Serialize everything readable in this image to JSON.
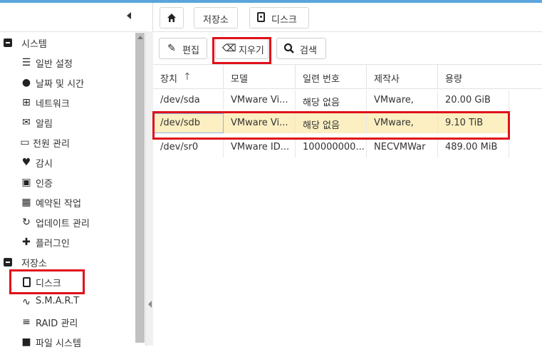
{
  "breadcrumb": {
    "home_icon": "home-icon",
    "storage": "저장소",
    "disk": "디스크"
  },
  "toolbar": {
    "edit": "편집",
    "wipe": "지우기",
    "search": "검색"
  },
  "sidebar": {
    "groups": [
      {
        "label": "시스템"
      },
      {
        "label": "저장소"
      }
    ],
    "system_items": [
      {
        "label": "일반 설정",
        "icon": "sliders-icon"
      },
      {
        "label": "날짜 및 시간",
        "icon": "clock-icon"
      },
      {
        "label": "네트워크",
        "icon": "network-icon"
      },
      {
        "label": "알림",
        "icon": "envelope-icon"
      },
      {
        "label": "전원 관리",
        "icon": "battery-icon"
      },
      {
        "label": "감시",
        "icon": "heartbeat-icon"
      },
      {
        "label": "인증",
        "icon": "certificate-icon"
      },
      {
        "label": "예약된 작업",
        "icon": "calendar-icon"
      },
      {
        "label": "업데이트 관리",
        "icon": "refresh-icon"
      },
      {
        "label": "플러그인",
        "icon": "puzzle-icon"
      }
    ],
    "storage_items": [
      {
        "label": "디스크",
        "icon": "disk-icon"
      },
      {
        "label": "S.M.A.R.T",
        "icon": "pulse-icon"
      },
      {
        "label": "RAID 관리",
        "icon": "database-icon"
      },
      {
        "label": "파일 시스템",
        "icon": "folder-icon"
      }
    ]
  },
  "table": {
    "columns": [
      "장치",
      "모델",
      "일련 번호",
      "제작사",
      "용량"
    ],
    "sort_indicator": "↑",
    "rows": [
      [
        "/dev/sda",
        "VMware Vi...",
        "해당 없음",
        "VMware,",
        "20.00 GiB"
      ],
      [
        "/dev/sdb",
        "VMware Vi...",
        "해당 없음",
        "VMware,",
        "9.10 TiB"
      ],
      [
        "/dev/sr0",
        "VMware ID...",
        "100000000...",
        "NECVMWar",
        "489.00 MiB"
      ]
    ],
    "selected_row": 1
  },
  "colors": {
    "accent": "#5aa6dc",
    "highlight": "#e0101a",
    "selected_row": "#fcefc1"
  }
}
